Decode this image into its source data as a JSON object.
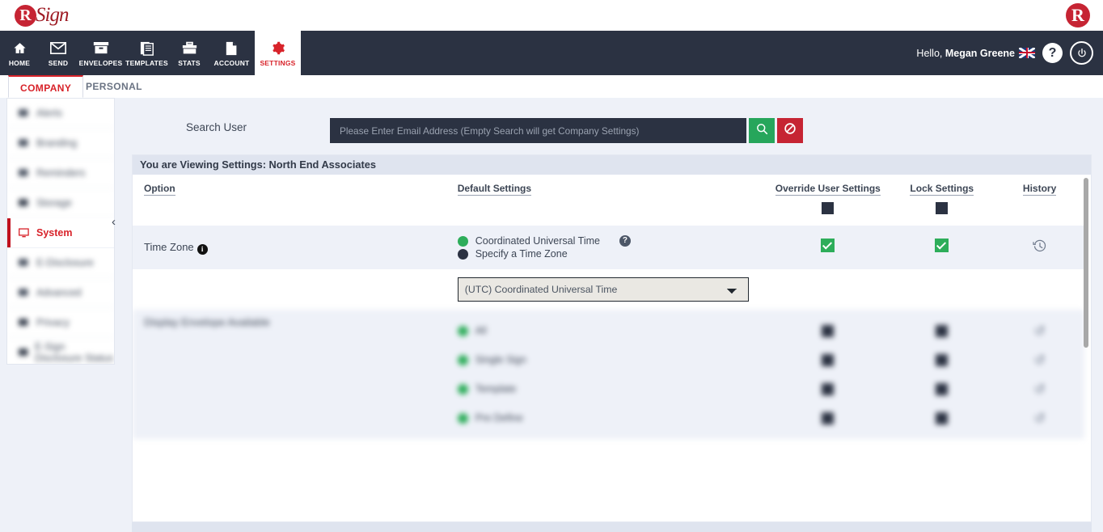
{
  "brand": {
    "logo_mark": "R",
    "logo_word": "Sign",
    "logo_right_mark": "R",
    "accent_red": "#d8232a",
    "nav_dark": "#2b3242",
    "green": "#2dad5a",
    "page_bg": "#eef1f8"
  },
  "nav": {
    "items": [
      {
        "label": "HOME",
        "icon": "home-icon"
      },
      {
        "label": "SEND",
        "icon": "envelope-icon"
      },
      {
        "label": "ENVELOPES",
        "icon": "archive-box-icon"
      },
      {
        "label": "TEMPLATES",
        "icon": "documents-icon"
      },
      {
        "label": "STATS",
        "icon": "briefcase-icon"
      },
      {
        "label": "ACCOUNT",
        "icon": "copy-files-icon"
      },
      {
        "label": "SETTINGS",
        "icon": "gear-icon"
      }
    ],
    "greeting_prefix": "Hello, ",
    "user_name": "Megan Greene",
    "language_flag": "uk-flag-icon",
    "help_glyph": "?",
    "power_glyph": "power-icon"
  },
  "tabs": [
    {
      "label": "COMPANY",
      "active": true
    },
    {
      "label": "PERSONAL",
      "active": false
    }
  ],
  "sidebar": {
    "items": [
      {
        "label": "Alerts",
        "blurred": true
      },
      {
        "label": "Branding",
        "blurred": true
      },
      {
        "label": "Reminders",
        "blurred": true
      },
      {
        "label": "Storage",
        "blurred": true
      },
      {
        "label": "System",
        "blurred": false,
        "icon": "monitor-icon"
      },
      {
        "label": "E-Disclosure",
        "blurred": true
      },
      {
        "label": "Advanced",
        "blurred": true
      },
      {
        "label": "Privacy",
        "blurred": true
      },
      {
        "label": "E-Sign Disclosure Status",
        "blurred": true
      }
    ],
    "collapse_glyph": "‹"
  },
  "search": {
    "label": "Search User",
    "placeholder": "Please Enter Email Address (Empty Search will get Company Settings)",
    "value": "",
    "go_icon": "search-icon",
    "clear_icon": "ban-icon"
  },
  "panel": {
    "title": "You are Viewing Settings: North End Associates",
    "columns": [
      {
        "key": "option",
        "label": "Option"
      },
      {
        "key": "default",
        "label": "Default Settings"
      },
      {
        "key": "override",
        "label": "Override User Settings"
      },
      {
        "key": "lock",
        "label": "Lock Settings"
      },
      {
        "key": "history",
        "label": "History"
      }
    ],
    "header_toggles": {
      "override_all": "unchecked",
      "lock_all": "unchecked"
    },
    "rows": [
      {
        "option": "Time Zone",
        "info_icon": "info-icon",
        "options": [
          {
            "label": "Coordinated Universal Time",
            "selected": true,
            "help_icon": "question-icon"
          },
          {
            "label": "Specify a Time Zone",
            "selected": false
          }
        ],
        "override": "checked",
        "lock": "checked",
        "history_icon": "history-icon"
      }
    ],
    "timezone_select": {
      "value": "(UTC) Coordinated Universal Time",
      "options": [
        "(UTC) Coordinated Universal Time"
      ]
    },
    "blurred_row": {
      "option": "Display Envelope Available",
      "items": [
        {
          "label": "All"
        },
        {
          "label": "Single Sign"
        },
        {
          "label": "Template"
        },
        {
          "label": "Pre Define"
        }
      ]
    }
  }
}
